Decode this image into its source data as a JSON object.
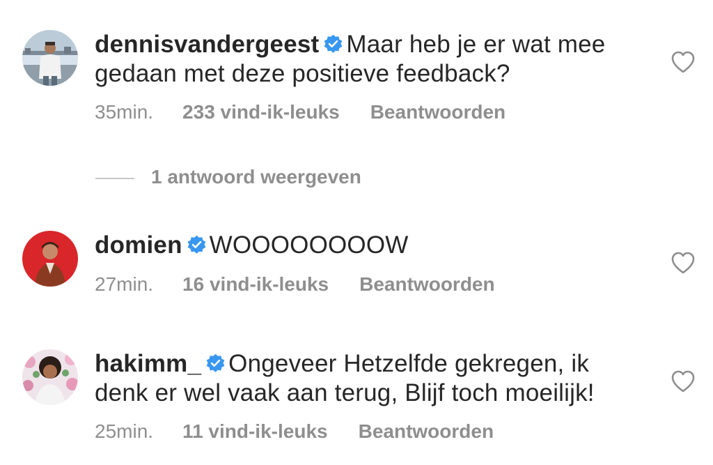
{
  "comments": [
    {
      "username": "dennisvandergeest",
      "text": "Maar heb je er wat mee gedaan met deze positieve feedback?",
      "time": "35min.",
      "likes": "233 vind-ik-leuks",
      "reply": "Beantwoorden",
      "avatar": "avatar-man-waterfront",
      "verified": true
    },
    {
      "username": "domien",
      "text": "WOOOOOOOOW",
      "time": "27min.",
      "likes": "16 vind-ik-leuks",
      "reply": "Beantwoorden",
      "avatar": "avatar-man-red-background",
      "verified": true
    },
    {
      "username": "hakimm_",
      "text": "Ongeveer Hetzelfde gekregen, ik denk er wel vaak aan terug, Blijf toch moeilijk!",
      "time": "25min.",
      "likes": "11 vind-ik-leuks",
      "reply": "Beantwoorden",
      "avatar": "avatar-man-curly-hair-flowers",
      "verified": true
    }
  ],
  "view_replies": "1 antwoord weergeven",
  "colors": {
    "text": "#262626",
    "meta": "#8e8e8e",
    "verified_badge": "#3897f0",
    "heart_outline": "#8e8e8e"
  },
  "icons": {
    "verified": "verified-badge-icon",
    "like": "heart-outline-icon"
  }
}
